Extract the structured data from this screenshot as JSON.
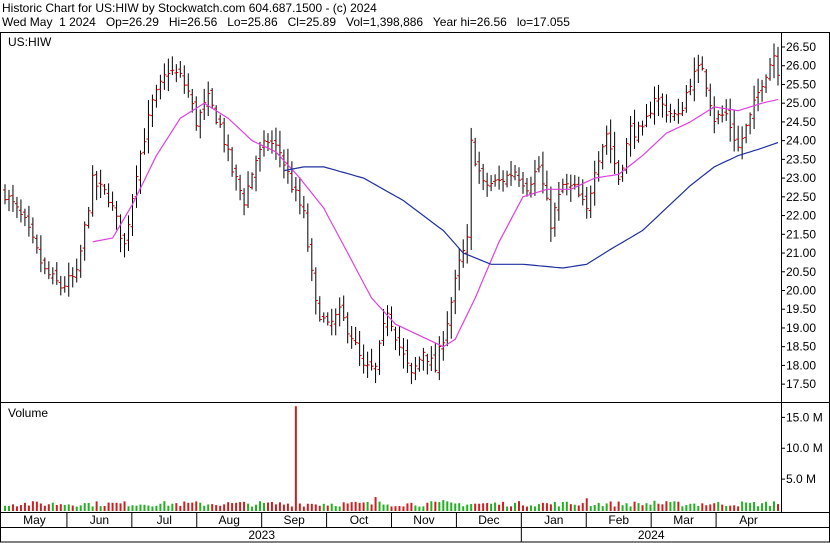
{
  "header": {
    "line1": "Historic Chart for US:HIW by Stockwatch.com 604.687.1500 - (c) 2024",
    "line2": "Wed May  1 2024   Op=26.29   Hi=26.56   Lo=25.86   Cl=25.89   Vol=1,398,886   Year hi=26.56   lo=17.055"
  },
  "colors": {
    "frame": "#000000",
    "price_bar": "#000000",
    "tick_open_close": "#cc0000",
    "ma_short": "#e040e0",
    "ma_long": "#2030a0",
    "vol_up": "#20b020",
    "vol_down": "#cc2020"
  },
  "chart_data": [
    {
      "type": "ohlc",
      "title": "US:HIW",
      "symbol_label": "US:HIW",
      "price_axis": {
        "range": [
          17.05,
          26.9
        ],
        "ticks": [
          17.5,
          18.0,
          18.5,
          19.0,
          19.5,
          20.0,
          20.5,
          21.0,
          21.5,
          22.0,
          22.5,
          23.0,
          23.5,
          24.0,
          24.5,
          25.0,
          25.5,
          26.0,
          26.5
        ],
        "tick_labels": [
          "17.50",
          "18.00",
          "18.50",
          "19.00",
          "19.50",
          "20.00",
          "20.50",
          "21.00",
          "21.50",
          "22.00",
          "22.50",
          "23.00",
          "23.50",
          "24.00",
          "24.50",
          "25.00",
          "25.50",
          "26.00",
          "26.50"
        ]
      },
      "months": [
        "May",
        "Jun",
        "Jul",
        "Aug",
        "Sep",
        "Oct",
        "Nov",
        "Dec",
        "Jan",
        "Feb",
        "Mar",
        "Apr"
      ],
      "years": [
        "2023",
        "2024"
      ],
      "close_anchors": [
        [
          0,
          22.6
        ],
        [
          5,
          21.8
        ],
        [
          10,
          20.5
        ],
        [
          14,
          20.1
        ],
        [
          18,
          20.4
        ],
        [
          22,
          22.9
        ],
        [
          26,
          22.5
        ],
        [
          30,
          21.2
        ],
        [
          33,
          23.2
        ],
        [
          37,
          25.0
        ],
        [
          41,
          25.9
        ],
        [
          44,
          25.7
        ],
        [
          46,
          25.3
        ],
        [
          48,
          24.5
        ],
        [
          51,
          25.1
        ],
        [
          54,
          24.4
        ],
        [
          57,
          23.2
        ],
        [
          60,
          22.4
        ],
        [
          63,
          23.5
        ],
        [
          66,
          24.0
        ],
        [
          69,
          23.7
        ],
        [
          72,
          22.8
        ],
        [
          75,
          22.0
        ],
        [
          78,
          19.6
        ],
        [
          81,
          19.0
        ],
        [
          84,
          19.4
        ],
        [
          87,
          18.8
        ],
        [
          90,
          17.9
        ],
        [
          93,
          17.9
        ],
        [
          96,
          19.5
        ],
        [
          99,
          18.5
        ],
        [
          102,
          17.7
        ],
        [
          105,
          18.4
        ],
        [
          108,
          17.9
        ],
        [
          111,
          19.2
        ],
        [
          114,
          20.7
        ],
        [
          116,
          21.3
        ],
        [
          117,
          23.9
        ],
        [
          120,
          22.8
        ],
        [
          124,
          22.9
        ],
        [
          128,
          23.2
        ],
        [
          131,
          22.8
        ],
        [
          134,
          23.3
        ],
        [
          137,
          21.8
        ],
        [
          140,
          22.8
        ],
        [
          143,
          22.7
        ],
        [
          146,
          22.1
        ],
        [
          148,
          23.3
        ],
        [
          151,
          24.2
        ],
        [
          154,
          23.0
        ],
        [
          157,
          24.3
        ],
        [
          160,
          24.2
        ],
        [
          163,
          25.2
        ],
        [
          166,
          24.8
        ],
        [
          169,
          24.6
        ],
        [
          172,
          25.6
        ],
        [
          175,
          26.0
        ],
        [
          178,
          24.6
        ],
        [
          181,
          24.7
        ],
        [
          184,
          23.8
        ],
        [
          187,
          24.6
        ],
        [
          190,
          25.6
        ],
        [
          193,
          26.3
        ],
        [
          194,
          25.9
        ]
      ],
      "ma_short_anchors": [
        [
          22,
          21.3
        ],
        [
          27,
          21.4
        ],
        [
          32,
          22.3
        ],
        [
          38,
          23.6
        ],
        [
          44,
          24.6
        ],
        [
          50,
          25.0
        ],
        [
          56,
          24.6
        ],
        [
          62,
          24.0
        ],
        [
          68,
          23.7
        ],
        [
          74,
          23.0
        ],
        [
          80,
          22.2
        ],
        [
          86,
          21.0
        ],
        [
          92,
          19.8
        ],
        [
          98,
          19.1
        ],
        [
          104,
          18.8
        ],
        [
          110,
          18.5
        ],
        [
          113,
          18.7
        ],
        [
          118,
          19.8
        ],
        [
          124,
          21.3
        ],
        [
          130,
          22.5
        ],
        [
          136,
          22.7
        ],
        [
          142,
          22.7
        ],
        [
          148,
          23.0
        ],
        [
          154,
          23.1
        ],
        [
          160,
          23.6
        ],
        [
          166,
          24.2
        ],
        [
          172,
          24.5
        ],
        [
          178,
          24.9
        ],
        [
          184,
          24.8
        ],
        [
          190,
          25.0
        ],
        [
          194,
          25.1
        ]
      ],
      "ma_long_anchors": [
        [
          70,
          23.2
        ],
        [
          75,
          23.3
        ],
        [
          80,
          23.3
        ],
        [
          90,
          23.0
        ],
        [
          100,
          22.4
        ],
        [
          110,
          21.6
        ],
        [
          115,
          21.0
        ],
        [
          122,
          20.7
        ],
        [
          130,
          20.7
        ],
        [
          140,
          20.6
        ],
        [
          146,
          20.7
        ],
        [
          152,
          21.1
        ],
        [
          160,
          21.6
        ],
        [
          166,
          22.2
        ],
        [
          172,
          22.8
        ],
        [
          178,
          23.3
        ],
        [
          184,
          23.6
        ],
        [
          190,
          23.8
        ],
        [
          194,
          23.95
        ]
      ],
      "n_days": 195
    },
    {
      "type": "bar",
      "title": "Volume",
      "axis": {
        "range": [
          0,
          17.0
        ],
        "ticks": [
          5.0,
          10.0,
          15.0
        ],
        "tick_labels": [
          "5.0 M",
          "10.0 M",
          "15.0 M"
        ]
      },
      "typical_volume_m": 1.0,
      "spikes": [
        [
          73,
          16.8
        ],
        [
          93,
          2.1
        ],
        [
          110,
          1.6
        ],
        [
          146,
          1.9
        ],
        [
          163,
          1.5
        ],
        [
          193,
          1.4
        ]
      ]
    }
  ]
}
